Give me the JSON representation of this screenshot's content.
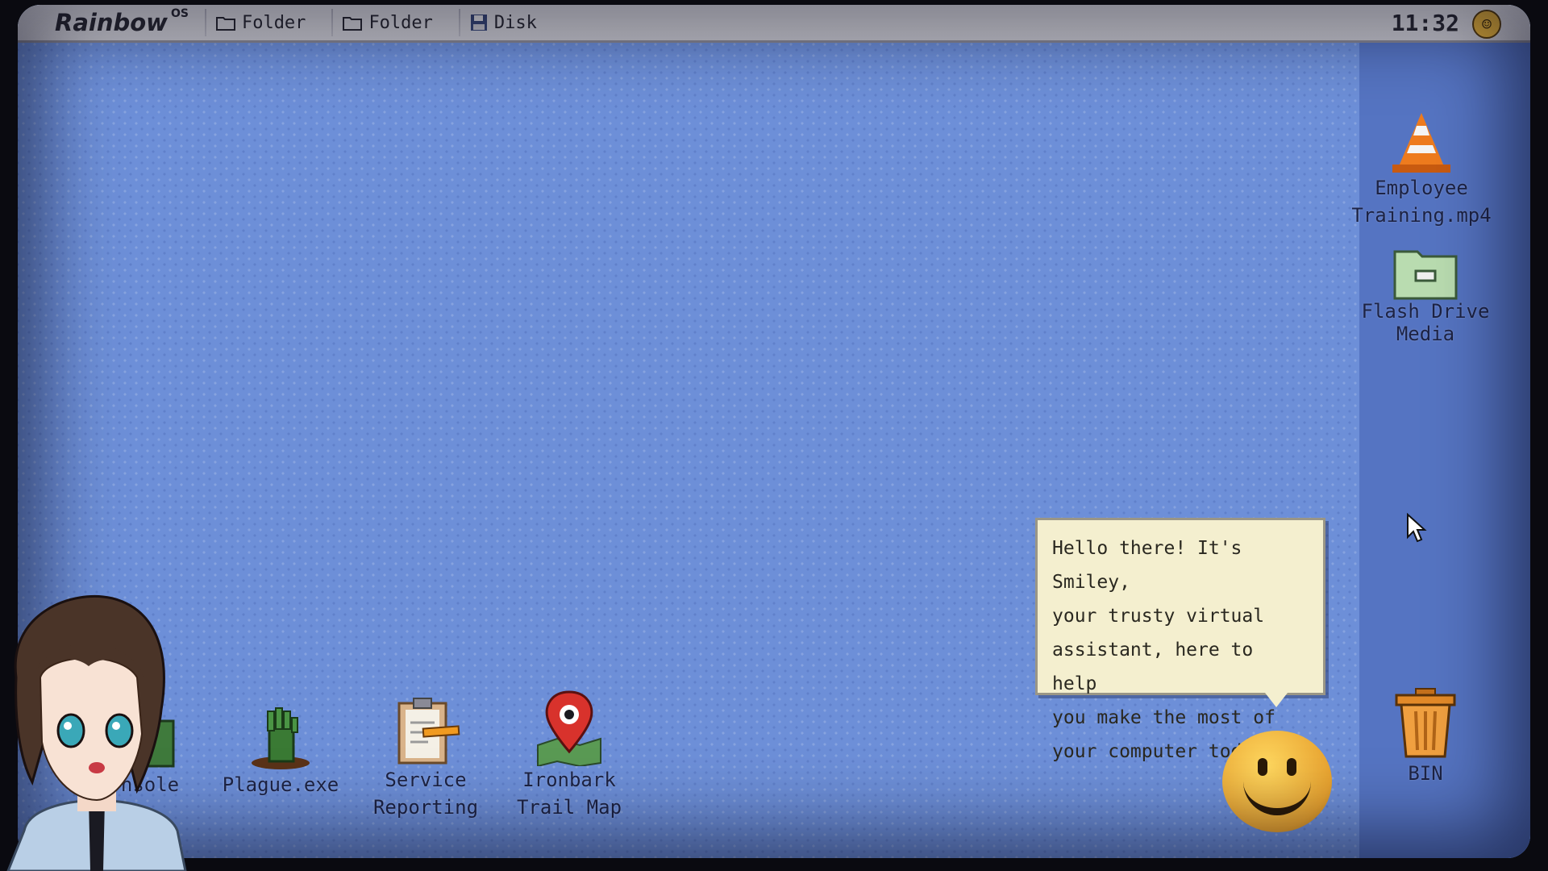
{
  "menubar": {
    "logo": "Rainbow",
    "logo_sup": "OS",
    "items": [
      {
        "label": "Folder",
        "icon": "folder-icon"
      },
      {
        "label": "Folder",
        "icon": "folder-icon"
      },
      {
        "label": "Disk",
        "icon": "disk-icon"
      }
    ],
    "clock": "11:32"
  },
  "desktop": {
    "right_icons": [
      {
        "label": "Employee\nTraining.mp4",
        "icon": "traffic-cone-icon"
      },
      {
        "label": "Flash Drive\nMedia",
        "icon": "flash-drive-folder-icon"
      },
      {
        "label": "BIN",
        "icon": "trash-bin-icon"
      }
    ],
    "bottom_icons": [
      {
        "label": "nsole",
        "icon": "console-icon"
      },
      {
        "label": "Plague.exe",
        "icon": "zombie-hand-icon"
      },
      {
        "label": "Service\nReporting",
        "icon": "clipboard-icon"
      },
      {
        "label": "Ironbark\nTrail Map",
        "icon": "map-pin-icon"
      }
    ]
  },
  "assistant": {
    "message": "Hello there! It's Smiley,\nyour trusty virtual\nassistant, here to help\nyou make the most of\nyour computer today."
  },
  "colors": {
    "desktop": "#6d8fd8",
    "side_panel": "#5574c2",
    "menubar": "#d8d8de",
    "bubble": "#f4efcf",
    "smiley": "#e8a330"
  }
}
